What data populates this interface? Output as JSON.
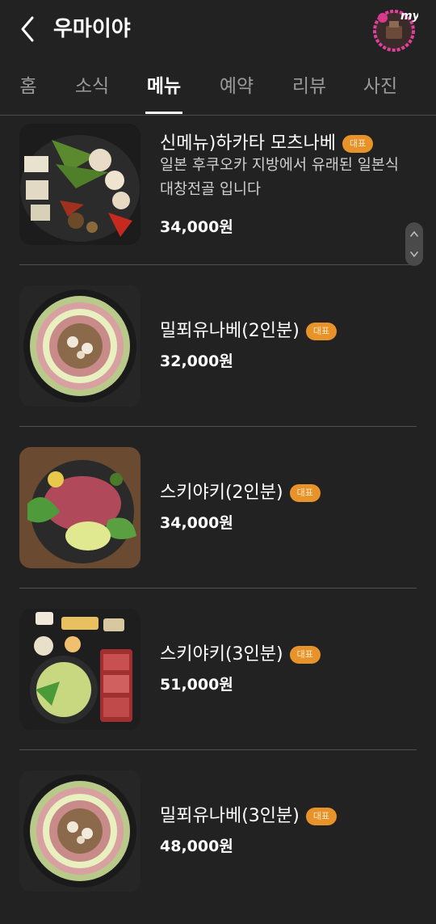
{
  "header": {
    "title": "우마이야",
    "back_icon": "chevron-left-icon",
    "logo_text": "my"
  },
  "tabs": [
    {
      "label": "홈",
      "active": false
    },
    {
      "label": "소식",
      "active": false
    },
    {
      "label": "메뉴",
      "active": true
    },
    {
      "label": "예약",
      "active": false
    },
    {
      "label": "리뷰",
      "active": false
    },
    {
      "label": "사진",
      "active": false
    }
  ],
  "menu": {
    "items": [
      {
        "name": "신메뉴)하카타 모츠나베",
        "badge": "대표",
        "description": "일본 후쿠오카 지방에서 유래된 일본식 대창전골 입니다",
        "price": "34,000원"
      },
      {
        "name": "밀푀유나베(2인분)",
        "badge": "대표",
        "price": "32,000원"
      },
      {
        "name": "스키야키(2인분)",
        "badge": "대표",
        "price": "34,000원"
      },
      {
        "name": "스키야키(3인분)",
        "badge": "대표",
        "price": "51,000원"
      },
      {
        "name": "밀푀유나베(3인분)",
        "badge": "대표",
        "price": "48,000원"
      }
    ]
  },
  "colors": {
    "background": "#222222",
    "badge": "#e8922a",
    "active_tab": "#ffffff",
    "inactive_tab": "#9a9a9a"
  }
}
